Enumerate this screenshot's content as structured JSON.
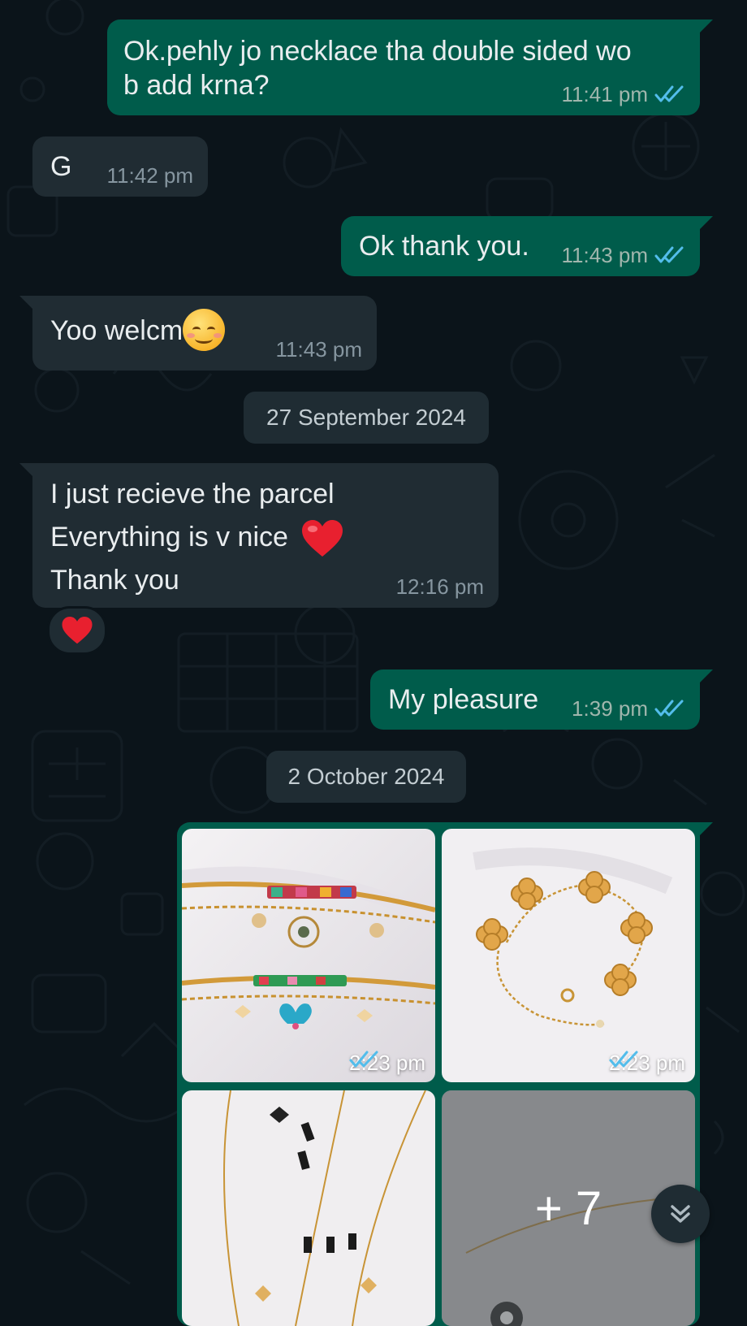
{
  "colors": {
    "background": "#0b141a",
    "outgoing_bubble": "#005c4b",
    "incoming_bubble": "#202c33",
    "read_tick": "#53bdeb"
  },
  "messages": [
    {
      "direction": "outgoing",
      "text_lines": [
        "Ok.pehly jo necklace tha double sided wo",
        "b add krna?"
      ],
      "time": "11:41 pm",
      "status": "read"
    },
    {
      "direction": "incoming",
      "text": "G",
      "time": "11:42 pm"
    },
    {
      "direction": "outgoing",
      "text": "Ok thank you.",
      "time": "11:43 pm",
      "status": "read"
    },
    {
      "direction": "incoming",
      "text": "Yoo welcm",
      "emoji": "smiling-face-icon",
      "time": "11:43 pm"
    },
    {
      "direction": "incoming",
      "text_lines": [
        "I just recieve the parcel",
        "Everything is v nice",
        "Thank you"
      ],
      "emoji": "red-heart-icon",
      "time": "12:16 pm",
      "reaction": "red-heart-icon"
    },
    {
      "direction": "outgoing",
      "text": "My pleasure",
      "time": "1:39 pm",
      "status": "read"
    }
  ],
  "date_separators": [
    "27 September 2024",
    "2 October 2024"
  ],
  "media_album": {
    "direction": "outgoing",
    "tiles": [
      {
        "subject": "bracelets",
        "time": "2:23 pm",
        "status": "read"
      },
      {
        "subject": "clover-bracelet",
        "time": "2:23 pm",
        "status": "read"
      },
      {
        "subject": "layered-necklace"
      },
      {
        "subject": "necklace",
        "more_count": "+ 7"
      }
    ]
  },
  "scroll_button": {
    "icon": "double-chevron-down-icon"
  }
}
